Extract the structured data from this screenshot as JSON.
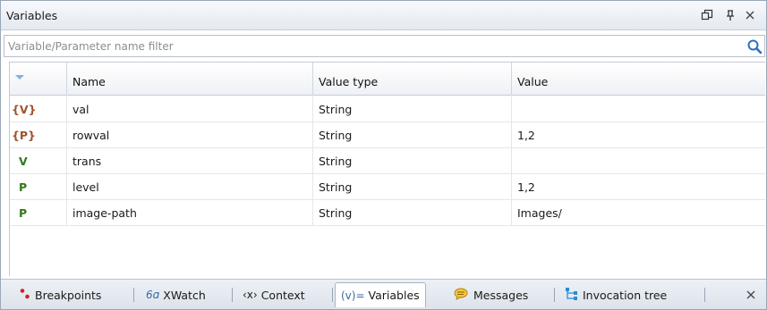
{
  "panel": {
    "title": "Variables"
  },
  "filter": {
    "placeholder": "Variable/Parameter name filter",
    "value": ""
  },
  "table": {
    "columns": [
      "",
      "Name",
      "Value type",
      "Value"
    ],
    "rows": [
      {
        "kind": "{V}",
        "kind_color": "#a0522d",
        "name": "val",
        "type": "String",
        "value": ""
      },
      {
        "kind": "{P}",
        "kind_color": "#a0522d",
        "name": "rowval",
        "type": "String",
        "value": "1,2"
      },
      {
        "kind": "V",
        "kind_color": "#2f7a1a",
        "name": "trans",
        "type": "String",
        "value": ""
      },
      {
        "kind": "P",
        "kind_color": "#2f7a1a",
        "name": "level",
        "type": "String",
        "value": "1,2"
      },
      {
        "kind": "P",
        "kind_color": "#2f7a1a",
        "name": "image-path",
        "type": "String",
        "value": "Images/"
      }
    ]
  },
  "tabs": [
    {
      "label": "Breakpoints",
      "icon": "breakpoints-icon",
      "active": false
    },
    {
      "label": "XWatch",
      "icon": "xwatch-icon",
      "active": false
    },
    {
      "label": "Context",
      "icon": "context-icon",
      "active": false
    },
    {
      "label": "Variables",
      "icon": "variables-icon",
      "active": true
    },
    {
      "label": "Messages",
      "icon": "messages-icon",
      "active": false
    },
    {
      "label": "Invocation tree",
      "icon": "invocation-tree-icon",
      "active": false
    }
  ],
  "icon_glyphs": {
    "context": "‹x›",
    "xwatch": "6ɑ",
    "variables": "(v)="
  }
}
